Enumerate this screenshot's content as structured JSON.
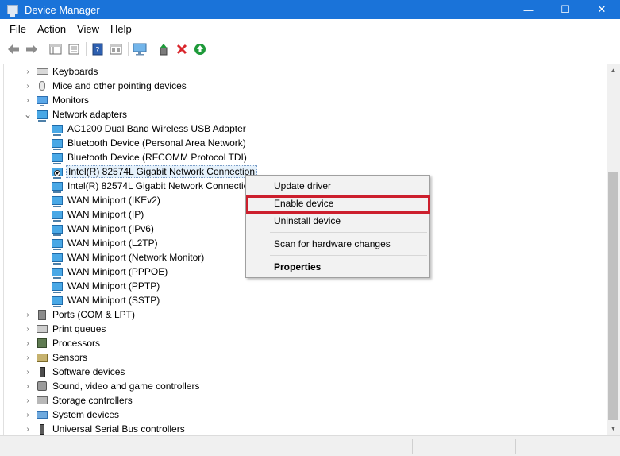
{
  "window": {
    "title": "Device Manager",
    "minimize_glyph": "—",
    "maximize_glyph": "☐",
    "close_glyph": "✕"
  },
  "menubar": {
    "items": [
      "File",
      "Action",
      "View",
      "Help"
    ]
  },
  "toolbar": {
    "buttons": [
      "back-icon",
      "forward-icon",
      "show-hide-tree-icon",
      "properties-icon",
      "help-icon",
      "view-icon",
      "monitor-icon",
      "update-driver-icon",
      "uninstall-icon",
      "enable-device-icon"
    ]
  },
  "tree": {
    "rows": [
      {
        "label": "Keyboards",
        "level": 0,
        "expander": "›",
        "icon": "keyboard-icon"
      },
      {
        "label": "Mice and other pointing devices",
        "level": 0,
        "expander": "›",
        "icon": "mouse-icon"
      },
      {
        "label": "Monitors",
        "level": 0,
        "expander": "›",
        "icon": "monitor-icon"
      },
      {
        "label": "Network adapters",
        "level": 0,
        "expander": "⌄",
        "icon": "network-adapter-icon"
      },
      {
        "label": "AC1200  Dual Band Wireless USB Adapter",
        "level": 1,
        "icon": "network-adapter-icon"
      },
      {
        "label": "Bluetooth Device (Personal Area Network)",
        "level": 1,
        "icon": "network-adapter-icon"
      },
      {
        "label": "Bluetooth Device (RFCOMM Protocol TDI)",
        "level": 1,
        "icon": "network-adapter-icon"
      },
      {
        "label": "Intel(R) 82574L Gigabit Network Connection",
        "level": 1,
        "icon": "disabled-network-adapter-icon",
        "selected": true
      },
      {
        "label": "Intel(R) 82574L Gigabit Network Connection",
        "level": 1,
        "icon": "network-adapter-icon"
      },
      {
        "label": "WAN Miniport (IKEv2)",
        "level": 1,
        "icon": "network-adapter-icon"
      },
      {
        "label": "WAN Miniport (IP)",
        "level": 1,
        "icon": "network-adapter-icon"
      },
      {
        "label": "WAN Miniport (IPv6)",
        "level": 1,
        "icon": "network-adapter-icon"
      },
      {
        "label": "WAN Miniport (L2TP)",
        "level": 1,
        "icon": "network-adapter-icon"
      },
      {
        "label": "WAN Miniport (Network Monitor)",
        "level": 1,
        "icon": "network-adapter-icon"
      },
      {
        "label": "WAN Miniport (PPPOE)",
        "level": 1,
        "icon": "network-adapter-icon"
      },
      {
        "label": "WAN Miniport (PPTP)",
        "level": 1,
        "icon": "network-adapter-icon"
      },
      {
        "label": "WAN Miniport (SSTP)",
        "level": 1,
        "icon": "network-adapter-icon"
      },
      {
        "label": "Ports (COM & LPT)",
        "level": 0,
        "expander": "›",
        "icon": "port-icon"
      },
      {
        "label": "Print queues",
        "level": 0,
        "expander": "›",
        "icon": "printer-icon"
      },
      {
        "label": "Processors",
        "level": 0,
        "expander": "›",
        "icon": "processor-icon"
      },
      {
        "label": "Sensors",
        "level": 0,
        "expander": "›",
        "icon": "sensor-icon"
      },
      {
        "label": "Software devices",
        "level": 0,
        "expander": "›",
        "icon": "software-device-icon"
      },
      {
        "label": "Sound, video and game controllers",
        "level": 0,
        "expander": "›",
        "icon": "sound-icon"
      },
      {
        "label": "Storage controllers",
        "level": 0,
        "expander": "›",
        "icon": "storage-icon"
      },
      {
        "label": "System devices",
        "level": 0,
        "expander": "›",
        "icon": "system-device-icon"
      },
      {
        "label": "Universal Serial Bus controllers",
        "level": 0,
        "expander": "›",
        "icon": "usb-icon"
      }
    ]
  },
  "context_menu": {
    "items": [
      {
        "label": "Update driver"
      },
      {
        "label": "Enable device",
        "highlighted": true
      },
      {
        "label": "Uninstall device"
      },
      {
        "label": "Scan for hardware changes"
      },
      {
        "label": "Properties",
        "bold": true
      }
    ],
    "highlight_color": "#cc1f2d"
  },
  "colors": {
    "titlebar": "#1a73d9",
    "selection": "#e5f1fb",
    "uninstall_red": "#d9252b",
    "enable_green": "#1e9a3a"
  }
}
